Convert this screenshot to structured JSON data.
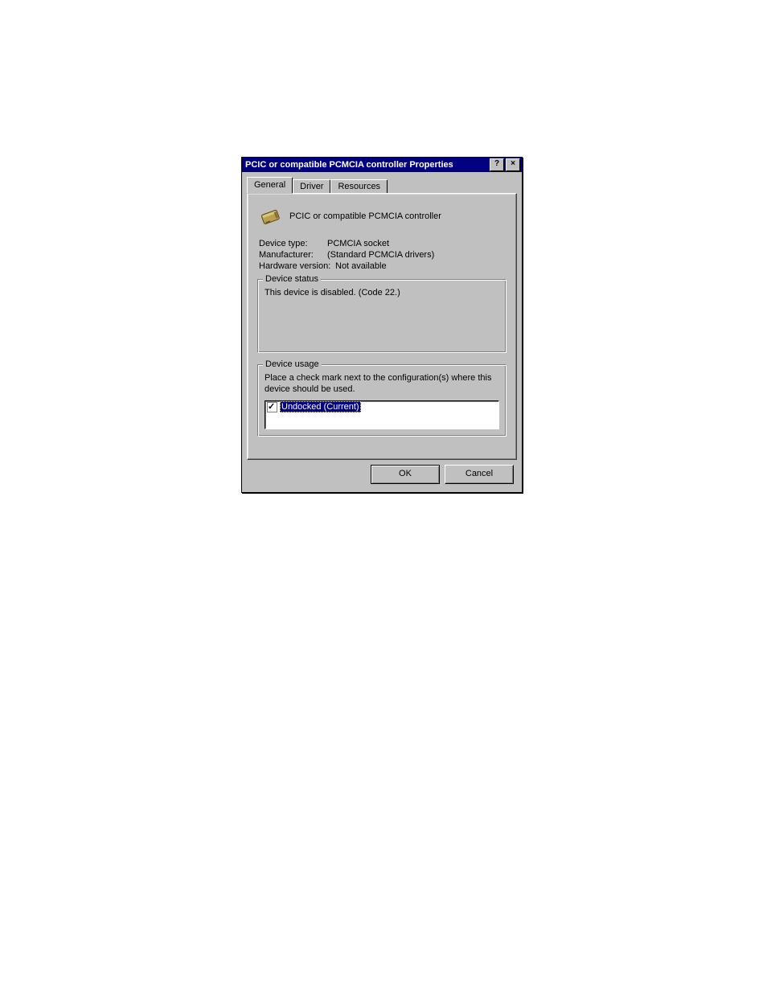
{
  "titlebar": {
    "title": "PCIC or compatible PCMCIA controller Properties",
    "help_label": "?",
    "close_label": "×"
  },
  "tabs": {
    "general": "General",
    "driver": "Driver",
    "resources": "Resources"
  },
  "device": {
    "name": "PCIC or compatible PCMCIA controller",
    "icon": "pcmcia-card-icon"
  },
  "info": {
    "type_label": "Device type:",
    "type_value": "PCMCIA socket",
    "mfr_label": "Manufacturer:",
    "mfr_value": "(Standard PCMCIA drivers)",
    "hw_label": "Hardware version:",
    "hw_value": "Not available"
  },
  "status": {
    "legend": "Device status",
    "text": "This device is disabled. (Code 22.)"
  },
  "usage": {
    "legend": "Device usage",
    "instruction": "Place a check mark next to the configuration(s) where this device should be used.",
    "items": [
      {
        "label": "Undocked (Current)",
        "checked": true
      }
    ]
  },
  "buttons": {
    "ok": "OK",
    "cancel": "Cancel"
  }
}
